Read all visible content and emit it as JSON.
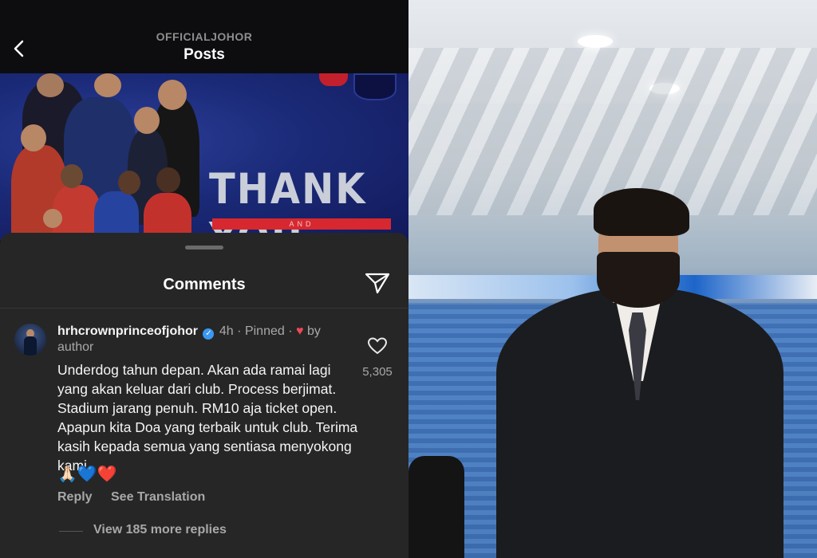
{
  "nav": {
    "account": "OFFICIALJOHOR",
    "title": "Posts"
  },
  "post_image": {
    "headline": "THANK YOU",
    "sub": "AND"
  },
  "comments": {
    "title": "Comments",
    "item": {
      "username": "hrhcrownprinceofjohor",
      "time": "4h",
      "pinned": "Pinned",
      "by_author": "by author",
      "text": "Underdog tahun depan. Akan ada ramai lagi yang akan keluar dari club. Process berjimat. Stadium jarang penuh. RM10 aja ticket open. Apapun kita Doa yang terbaik untuk club. Terima kasih kepada semua yang sentiasa menyokong kami.",
      "emojis": "🙏🏻💙❤️",
      "likes": "5,305",
      "reply_label": "Reply",
      "translate_label": "See Translation",
      "view_replies": "View 185 more replies"
    }
  },
  "icons": {
    "back": "chevron-left-icon",
    "share": "paper-plane-icon",
    "like": "heart-outline-icon",
    "verified": "verified-badge-icon",
    "liked_by_author": "red-heart-icon"
  },
  "colors": {
    "sheet_bg": "#262626",
    "text_primary": "#f5f5f5",
    "text_secondary": "#a8a8a8",
    "verified": "#3b97f0",
    "heart": "#ed4956"
  }
}
